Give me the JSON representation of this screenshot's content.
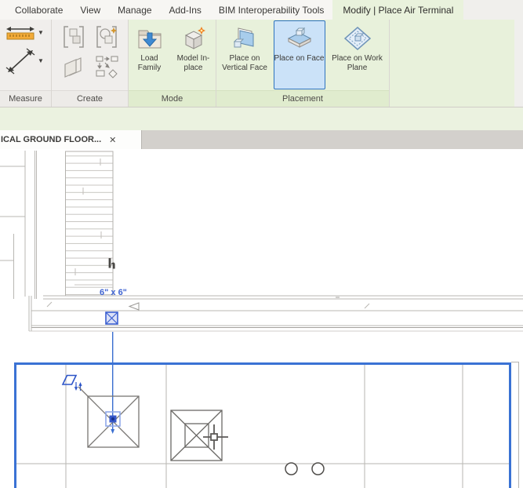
{
  "tabs": [
    {
      "label": "Collaborate"
    },
    {
      "label": "View"
    },
    {
      "label": "Manage"
    },
    {
      "label": "Add-Ins"
    },
    {
      "label": "BIM Interoperability Tools"
    },
    {
      "label": "Modify | Place Air Terminal",
      "active": true
    }
  ],
  "ribbon": {
    "panels": [
      {
        "label": "Measure"
      },
      {
        "label": "Create"
      },
      {
        "label": "Mode",
        "buttons": [
          {
            "label": "Load Family"
          },
          {
            "label": "Model In-place"
          }
        ]
      },
      {
        "label": "Placement",
        "buttons": [
          {
            "label": "Place on Vertical Face"
          },
          {
            "label": "Place on Face",
            "selected": true
          },
          {
            "label": "Place on Work Plane"
          }
        ]
      }
    ]
  },
  "view_tab": {
    "label": "ICAL GROUND FLOOR...",
    "close": "✕"
  },
  "canvas": {
    "size_label": "6\" x 6\""
  },
  "colors": {
    "ribbon_green": "#e8f1db",
    "selected_button_blue": "#cbe2f8",
    "selection_blue": "#3a6ed0",
    "dimension_text_blue": "#3e63d2"
  }
}
